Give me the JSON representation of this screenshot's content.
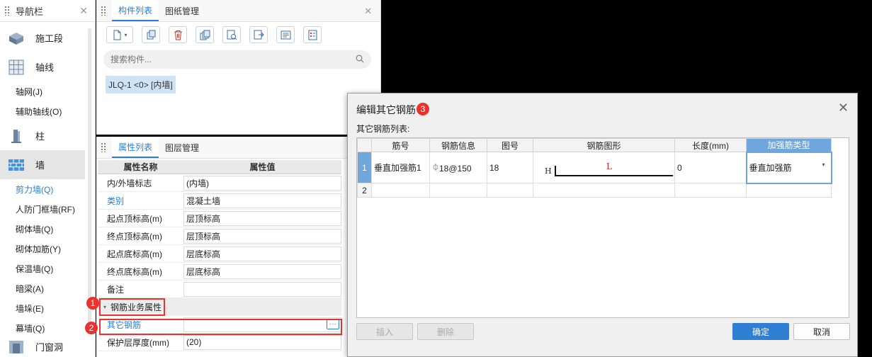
{
  "nav": {
    "title": "导航栏",
    "categories": {
      "segment": "施工段",
      "axis": "轴线",
      "column": "柱",
      "wall": "墙",
      "opening": "门窗洞"
    },
    "axis_items": [
      "轴网(J)",
      "辅助轴线(O)"
    ],
    "wall_items": [
      "剪力墙(Q)",
      "人防门框墙(RF)",
      "砌体墙(Q)",
      "砌体加筋(Y)",
      "保温墙(Q)",
      "暗梁(A)",
      "墙垛(E)",
      "幕墙(Q)"
    ]
  },
  "component_panel": {
    "tabs": [
      "构件列表",
      "图纸管理"
    ],
    "search_placeholder": "搜索构件...",
    "item": "JLQ-1 <0> [内墙]"
  },
  "property_panel": {
    "tabs": [
      "属性列表",
      "图层管理"
    ],
    "headers": [
      "属性名称",
      "属性值"
    ],
    "rows": [
      {
        "name": "内/外墙标志",
        "value": "(内墙)"
      },
      {
        "name": "类别",
        "value": "混凝土墙"
      },
      {
        "name": "起点顶标高(m)",
        "value": "层顶标高"
      },
      {
        "name": "终点顶标高(m)",
        "value": "层顶标高"
      },
      {
        "name": "起点底标高(m)",
        "value": "层底标高"
      },
      {
        "name": "终点底标高(m)",
        "value": "层底标高"
      },
      {
        "name": "备注",
        "value": ""
      }
    ],
    "group": "钢筋业务属性",
    "other_rebar": {
      "name": "其它钢筋",
      "value": "",
      "button": "···"
    },
    "cover": {
      "name": "保护层厚度(mm)",
      "value": "(20)"
    }
  },
  "badges": [
    "1",
    "2",
    "3"
  ],
  "dialog": {
    "title": "编辑其它钢筋",
    "list_label": "其它钢筋列表:",
    "columns": [
      "筋号",
      "钢筋信息",
      "图号",
      "钢筋图形",
      "长度(mm)",
      "加强筋类型"
    ],
    "rows": [
      {
        "num": "1",
        "name": "垂直加强筋1",
        "info": "18@150",
        "fig": "18",
        "shape_h": "H",
        "shape_l": "L",
        "length": "0",
        "type": "垂直加强筋"
      },
      {
        "num": "2",
        "name": "",
        "info": "",
        "fig": "",
        "shape_h": "",
        "shape_l": "",
        "length": "",
        "type": ""
      }
    ],
    "buttons": {
      "insert": "插入",
      "delete": "删除",
      "ok": "确定",
      "cancel": "取消"
    }
  },
  "colors": {
    "accent": "#2a7fd4",
    "badge": "#e8332f",
    "header_highlight": "#6fa7dc"
  }
}
